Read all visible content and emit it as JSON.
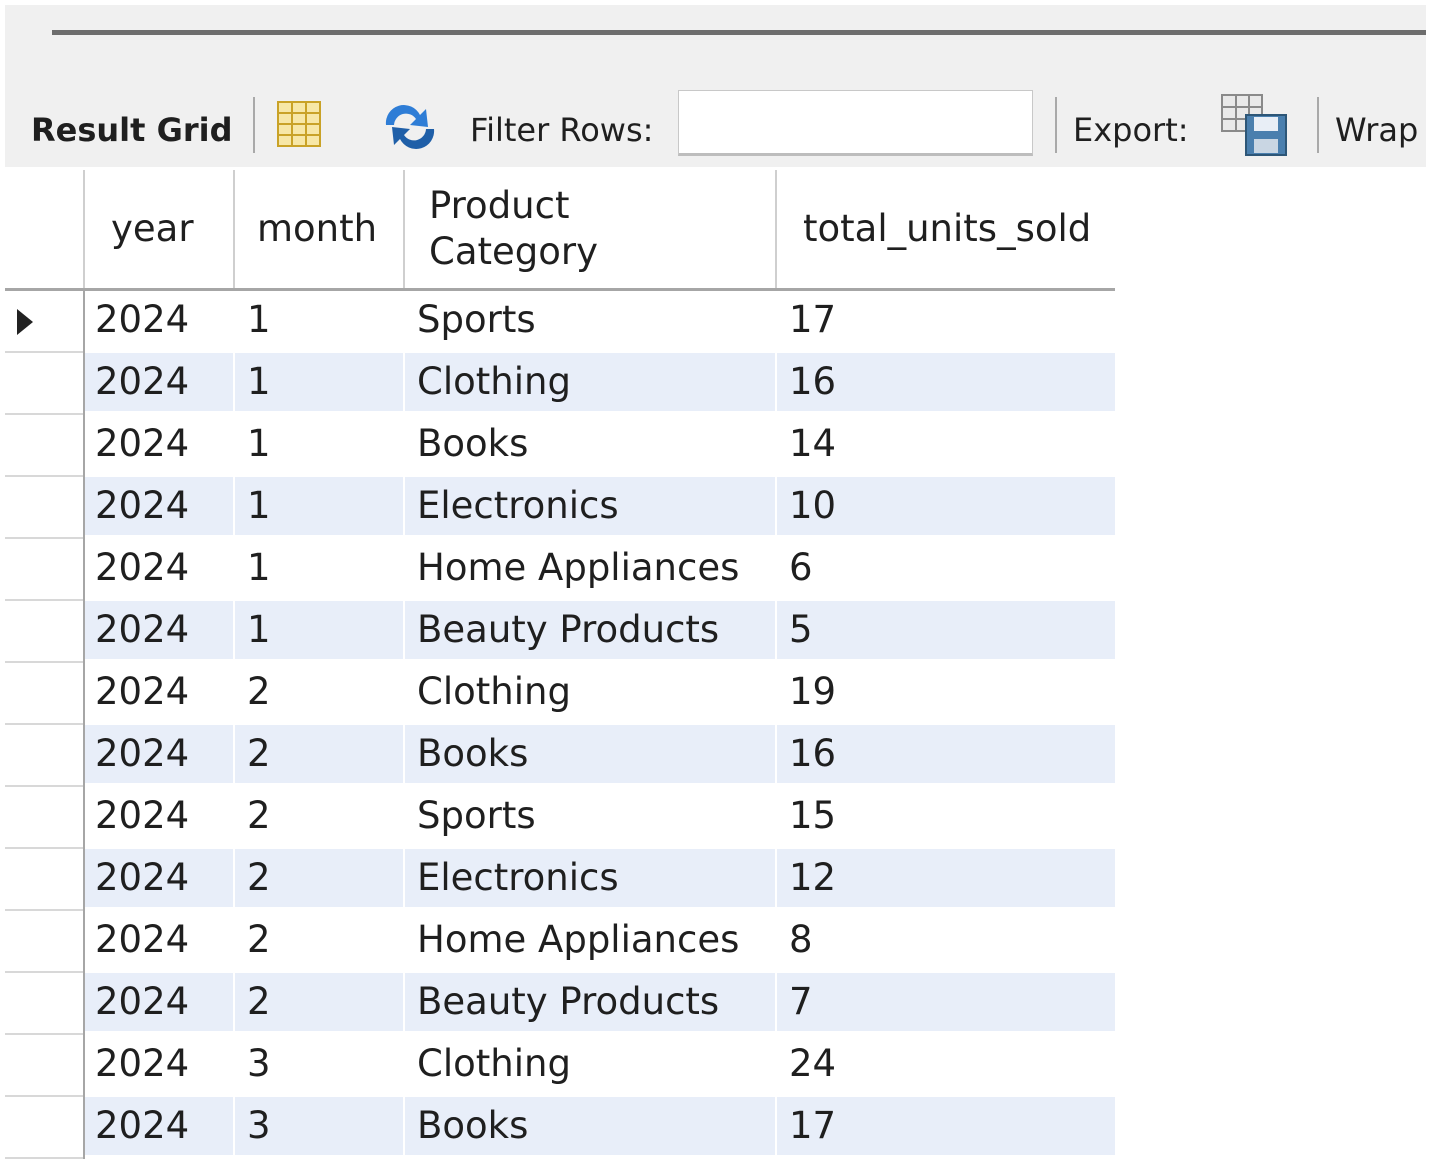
{
  "toolbar": {
    "result_grid_label": "Result Grid",
    "filter_rows_label": "Filter Rows:",
    "filter_rows_value": "",
    "export_label": "Export:",
    "wrap_label": "Wrap",
    "icons": [
      "grid-layout-icon",
      "refresh-icon",
      "export-save-icon"
    ]
  },
  "grid": {
    "columns": [
      "year",
      "month",
      "Product Category",
      "total_units_sold"
    ],
    "rows": [
      [
        "2024",
        "1",
        "Sports",
        "17"
      ],
      [
        "2024",
        "1",
        "Clothing",
        "16"
      ],
      [
        "2024",
        "1",
        "Books",
        "14"
      ],
      [
        "2024",
        "1",
        "Electronics",
        "10"
      ],
      [
        "2024",
        "1",
        "Home Appliances",
        "6"
      ],
      [
        "2024",
        "1",
        "Beauty Products",
        "5"
      ],
      [
        "2024",
        "2",
        "Clothing",
        "19"
      ],
      [
        "2024",
        "2",
        "Books",
        "16"
      ],
      [
        "2024",
        "2",
        "Sports",
        "15"
      ],
      [
        "2024",
        "2",
        "Electronics",
        "12"
      ],
      [
        "2024",
        "2",
        "Home Appliances",
        "8"
      ],
      [
        "2024",
        "2",
        "Beauty Products",
        "7"
      ],
      [
        "2024",
        "3",
        "Clothing",
        "24"
      ],
      [
        "2024",
        "3",
        "Books",
        "17"
      ]
    ],
    "selected_row": 0
  }
}
